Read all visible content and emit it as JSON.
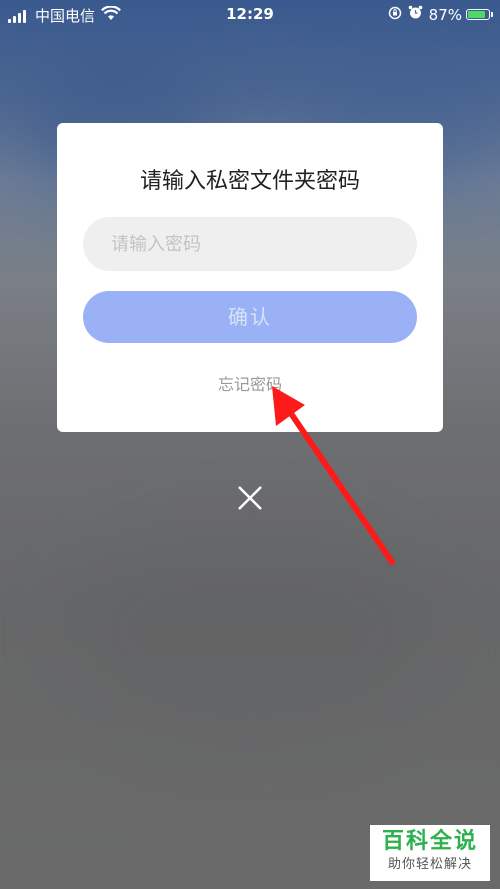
{
  "status_bar": {
    "carrier": "中国电信",
    "time": "12:29",
    "battery_percent": "87%",
    "icons": [
      "signal-icon",
      "wifi-icon",
      "rotation-lock-icon",
      "alarm-icon",
      "battery-icon"
    ]
  },
  "dialog": {
    "title": "请输入私密文件夹密码",
    "password_placeholder": "请输入密码",
    "confirm_label": "确认",
    "forgot_label": "忘记密码"
  },
  "close": {
    "icon": "close-icon"
  },
  "annotation": {
    "color": "#ff1a1a"
  },
  "watermark": {
    "title": "百科全说",
    "subtitle": "助你轻松解决"
  },
  "colors": {
    "confirm_bg": "#9ab2f5",
    "watermark_green": "#2bb24c"
  }
}
